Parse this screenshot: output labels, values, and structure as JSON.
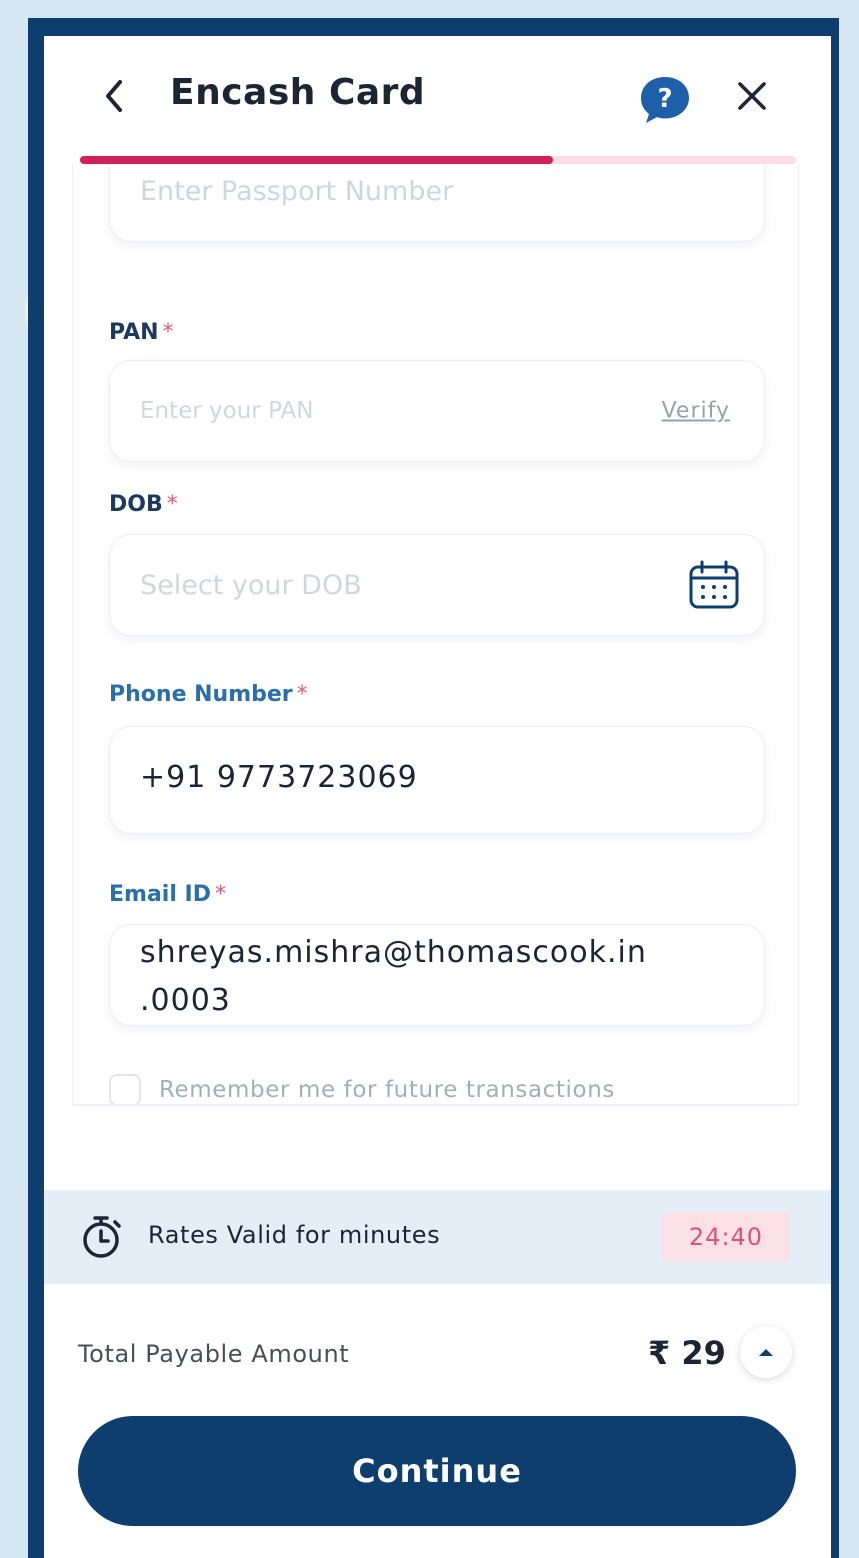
{
  "header": {
    "title": "Encash Card"
  },
  "progress": {
    "fraction": 0.66
  },
  "form": {
    "passport": {
      "placeholder": "Enter Passport Number",
      "value": ""
    },
    "pan": {
      "label": "PAN",
      "required_mark": "*",
      "placeholder": "Enter your PAN",
      "verify_label": "Verify"
    },
    "dob": {
      "label": "DOB",
      "required_mark": "*",
      "placeholder": "Select your DOB"
    },
    "phone": {
      "label": "Phone Number",
      "required_mark": "*",
      "value": "+91 9773723069"
    },
    "email": {
      "label": "Email ID",
      "required_mark": "*",
      "value_line1": "shreyas.mishra@thomascook.in",
      "value_line2": ".0003"
    },
    "remember": {
      "label": "Remember me for future transactions",
      "checked": false
    }
  },
  "rates": {
    "text": "Rates Valid for minutes",
    "timer": "24:40"
  },
  "total": {
    "label": "Total Payable Amount",
    "amount": "₹ 29"
  },
  "actions": {
    "continue_label": "Continue"
  },
  "colors": {
    "brand_navy": "#0d3e6e",
    "accent_pink": "#d21f55",
    "timer_text": "#d9547c",
    "strip_bg": "#e3eef7",
    "help_blue": "#1f5fa8"
  },
  "icons": {
    "back": "chevron-left-icon",
    "help": "help-chat-icon",
    "close": "close-icon",
    "calendar": "calendar-icon",
    "timer": "stopwatch-icon",
    "expand": "chevron-up-icon"
  }
}
